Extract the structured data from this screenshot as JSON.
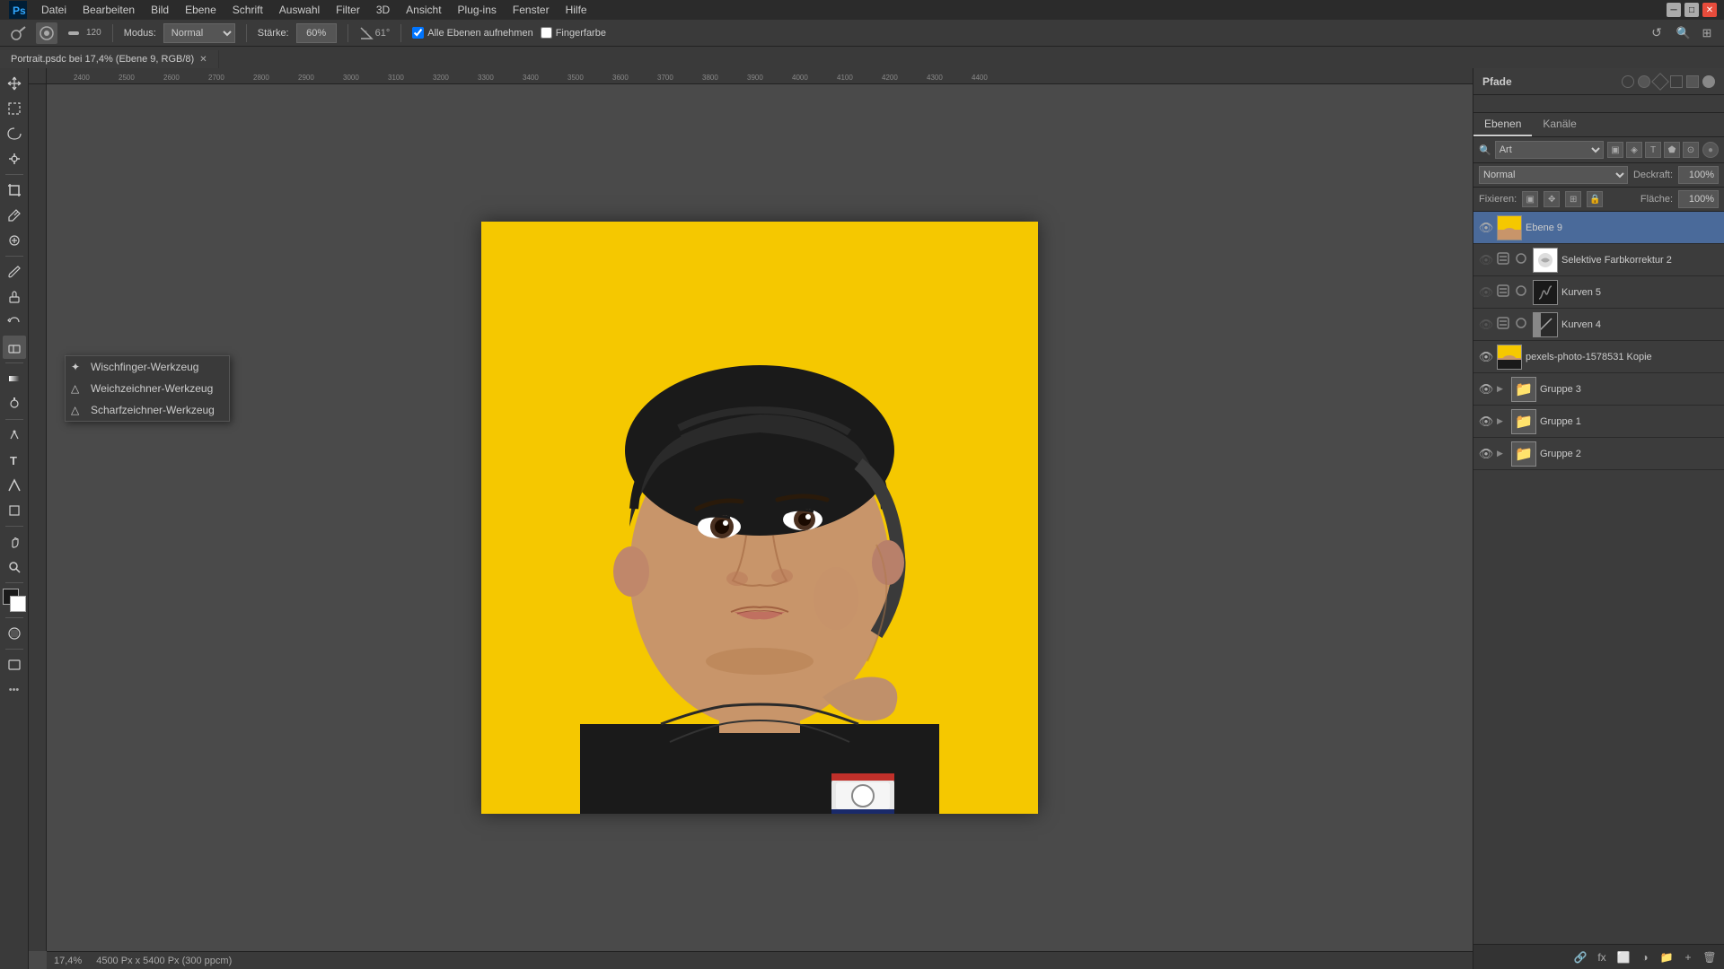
{
  "app": {
    "title": "Adobe Photoshop",
    "menu_items": [
      "Datei",
      "Bearbeiten",
      "Bild",
      "Ebene",
      "Schrift",
      "Auswahl",
      "Filter",
      "3D",
      "Ansicht",
      "Plug-ins",
      "Fenster",
      "Hilfe"
    ]
  },
  "options_bar": {
    "mode_label": "Modus:",
    "mode_value": "Normal",
    "strength_label": "Stärke:",
    "strength_value": "60%",
    "angle_value": "61°",
    "sample_label": "Alle Ebenen aufnehmen",
    "finger_label": "Fingerfarbe"
  },
  "tab": {
    "filename": "Portrait.psdc bei 17,4% (Ebene 9, RGB/8)",
    "modified": true
  },
  "context_menu": {
    "items": [
      {
        "label": "Wischfinger-Werkzeug",
        "icon": "✦"
      },
      {
        "label": "Weichzeichner-Werkzeug",
        "icon": "△"
      },
      {
        "label": "Scharfzeichner-Werkzeug",
        "icon": "△"
      }
    ]
  },
  "right_panel": {
    "paths_title": "Pfade",
    "layers_tab": "Ebenen",
    "channels_tab": "Kanäle",
    "search_placeholder": "Art",
    "blend_mode": "Normal",
    "opacity_label": "Deckraft:",
    "opacity_value": "100%",
    "fix_label": "Fixieren:",
    "fill_label": "Fläche:",
    "fill_value": "100%",
    "layers": [
      {
        "name": "Ebene 9",
        "type": "normal",
        "thumb": "portrait",
        "visible": true,
        "selected": true,
        "icons": []
      },
      {
        "name": "Selektive Farbkorrektur 2",
        "type": "adjustment",
        "thumb": "adj-white",
        "visible": false,
        "selected": false,
        "icons": [
          "extra",
          "extra"
        ]
      },
      {
        "name": "Kurven 5",
        "type": "adjustment",
        "thumb": "adj-black",
        "visible": false,
        "selected": false,
        "icons": [
          "extra",
          "extra"
        ]
      },
      {
        "name": "Kurven 4",
        "type": "adjustment",
        "thumb": "adj-black2",
        "visible": false,
        "selected": false,
        "icons": [
          "extra",
          "extra"
        ]
      },
      {
        "name": "pexels-photo-1578531 Kopie",
        "type": "image",
        "thumb": "photo",
        "visible": true,
        "selected": false,
        "icons": []
      },
      {
        "name": "Gruppe 3",
        "type": "group",
        "thumb": "folder",
        "visible": true,
        "selected": false,
        "icons": []
      },
      {
        "name": "Gruppe 1",
        "type": "group",
        "thumb": "folder",
        "visible": true,
        "selected": false,
        "icons": []
      },
      {
        "name": "Gruppe 2",
        "type": "group",
        "thumb": "folder",
        "visible": true,
        "selected": false,
        "icons": []
      }
    ]
  },
  "status_bar": {
    "zoom": "17,4%",
    "dimensions": "4500 Px x 5400 Px (300 ppcm)"
  },
  "colors": {
    "bg_canvas": "#4a4a4a",
    "portrait_bg": "#f5c800",
    "ui_bg": "#3c3c3c",
    "panel_bg": "#3a3a3a",
    "selected_layer": "#4a6a9a",
    "accent": "#4a7fd4"
  }
}
